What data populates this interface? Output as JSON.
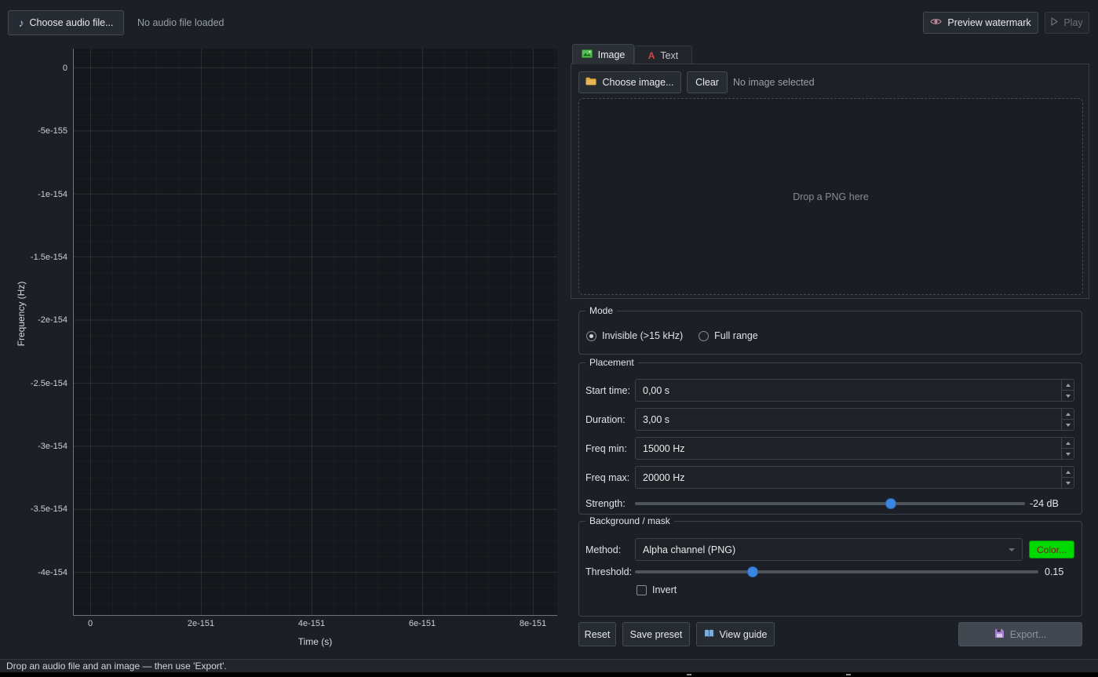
{
  "topbar": {
    "choose_audio_label": "Choose audio file...",
    "audio_status": "No audio file loaded",
    "preview_label": "Preview watermark",
    "play_label": "Play"
  },
  "plot": {
    "ylabel": "Frequency (Hz)",
    "xlabel": "Time (s)",
    "y_ticks": [
      "0",
      "-5e-155",
      "-1e-154",
      "-1.5e-154",
      "-2e-154",
      "-2.5e-154",
      "-3e-154",
      "-3.5e-154",
      "-4e-154"
    ],
    "x_ticks": [
      "0",
      "2e-151",
      "4e-151",
      "6e-151",
      "8e-151"
    ]
  },
  "watermark_tabs": {
    "image_label": "Image",
    "text_label": "Text"
  },
  "image_tab": {
    "choose_image_label": "Choose image...",
    "clear_label": "Clear",
    "status": "No image selected",
    "dropzone_hint": "Drop a PNG here"
  },
  "mode_group": {
    "title": "Mode",
    "invisible_label": "Invisible (>15 kHz)",
    "full_range_label": "Full range"
  },
  "placement_group": {
    "title": "Placement",
    "start_time_label": "Start time:",
    "start_time_value": "0,00 s",
    "duration_label": "Duration:",
    "duration_value": "3,00 s",
    "freq_min_label": "Freq min:",
    "freq_min_value": "15000 Hz",
    "freq_max_label": "Freq max:",
    "freq_max_value": "20000 Hz",
    "strength_label": "Strength:",
    "strength_value": "-24 dB"
  },
  "mask_group": {
    "title": "Background / mask",
    "method_label": "Method:",
    "method_value": "Alpha channel (PNG)",
    "color_button_label": "Color...",
    "threshold_label": "Threshold:",
    "threshold_value": "0.15",
    "invert_label": "Invert"
  },
  "actions": {
    "reset_label": "Reset",
    "save_preset_label": "Save preset",
    "view_guide_label": "View guide",
    "export_label": "Export..."
  },
  "statusbar": {
    "message": "Drop an audio file and an image — then use 'Export'."
  },
  "colors": {
    "accent_blue": "#3b86e0",
    "color_swatch_green": "#00d900",
    "image_tab_icon_green": "#58bd58",
    "text_tab_icon_red": "#d64545"
  }
}
